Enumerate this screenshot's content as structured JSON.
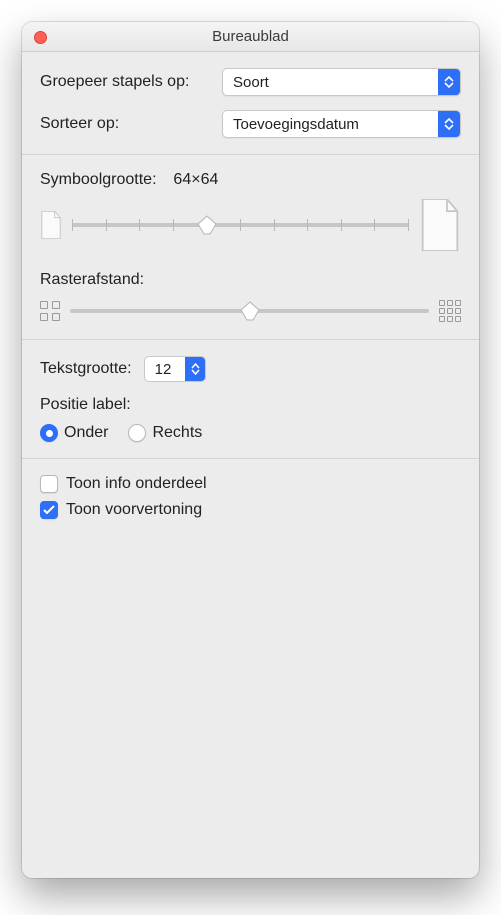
{
  "window": {
    "title": "Bureaublad"
  },
  "grouping": {
    "group_label": "Groepeer stapels op:",
    "group_value": "Soort",
    "sort_label": "Sorteer op:",
    "sort_value": "Toevoegingsdatum"
  },
  "icon_section": {
    "size_label": "Symboolgrootte:",
    "size_value": "64×64",
    "spacing_label": "Rasterafstand:",
    "size_slider_percent": 40,
    "spacing_slider_percent": 50
  },
  "text_section": {
    "text_size_label": "Tekstgrootte:",
    "text_size_value": "12",
    "position_label": "Positie label:",
    "radio_under": "Onder",
    "radio_right": "Rechts"
  },
  "toggles": {
    "show_item_info": "Toon info onderdeel",
    "show_preview": "Toon voorvertoning"
  }
}
